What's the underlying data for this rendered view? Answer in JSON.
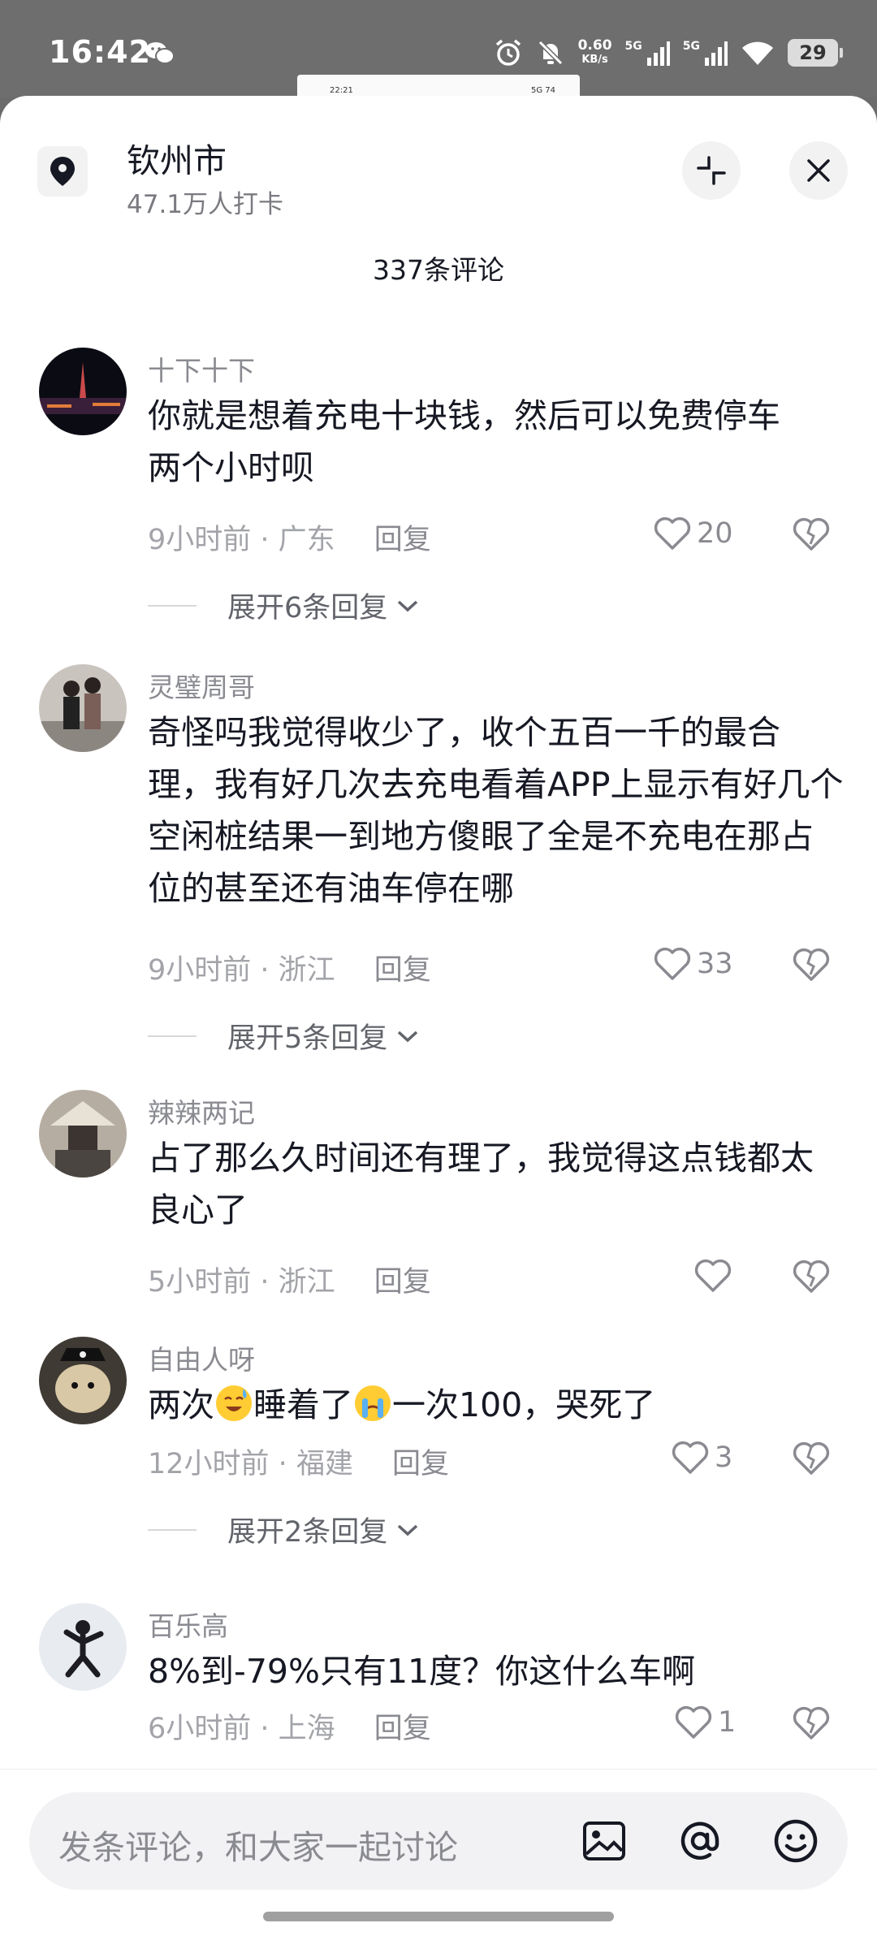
{
  "status": {
    "time": "16:42",
    "net_speed_value": "0.60",
    "net_speed_unit": "KB/s",
    "sig1": "5G",
    "sig2": "5G",
    "battery": "29"
  },
  "mini_screenshot": {
    "time": "22:21",
    "icons": "5G 74"
  },
  "header": {
    "location": "钦州市",
    "checkins": "47.1万人打卡",
    "comment_count": "337条评论"
  },
  "comments": [
    {
      "user": "十下十下",
      "text": "你就是想着充电十块钱，然后可以免费停车两个小时呗",
      "time": "9小时前",
      "region": "广东",
      "reply": "回复",
      "likes": "20",
      "expand": "展开6条回复"
    },
    {
      "user": "灵璧周哥",
      "text": "奇怪吗我觉得收少了，收个五百一千的最合理，我有好几次去充电看着APP上显示有好几个空闲桩结果一到地方傻眼了全是不充电在那占位的甚至还有油车停在哪",
      "time": "9小时前",
      "region": "浙江",
      "reply": "回复",
      "likes": "33",
      "expand": "展开5条回复"
    },
    {
      "user": "辣辣两记",
      "text": "占了那么久时间还有理了，我觉得这点钱都太良心了",
      "time": "5小时前",
      "region": "浙江",
      "reply": "回复",
      "likes": ""
    },
    {
      "user": "自由人呀",
      "text_parts": [
        "两次",
        "睡着了",
        "一次100，哭死了"
      ],
      "emojis": [
        "sweat-smile-emoji",
        "crying-emoji"
      ],
      "time": "12小时前",
      "region": "福建",
      "reply": "回复",
      "likes": "3",
      "expand": "展开2条回复"
    },
    {
      "user": "百乐高",
      "text": "8%到-79%只有11度？你这什么车啊",
      "time": "6小时前",
      "region": "上海",
      "reply": "回复",
      "likes": "1"
    }
  ],
  "meta_separator": " · ",
  "input": {
    "placeholder": "发条评论，和大家一起讨论"
  },
  "colors": {
    "text_primary": "#161823",
    "text_secondary": "#8a8b91",
    "sheet_bg": "#ffffff"
  }
}
